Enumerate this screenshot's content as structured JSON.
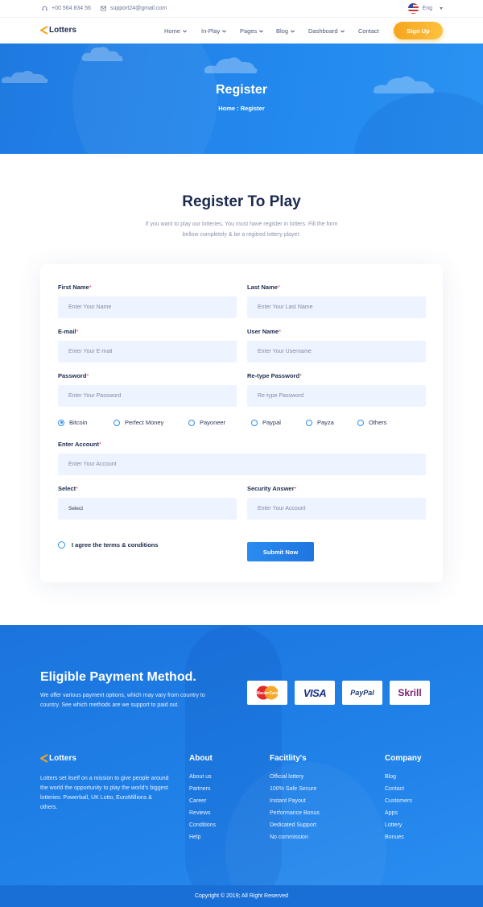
{
  "topbar": {
    "phone": "+00 564 834 56",
    "email": "support24@gmail.com",
    "language": "Eng"
  },
  "nav": {
    "logo": "Lotters",
    "items": [
      {
        "label": "Home",
        "dropdown": true
      },
      {
        "label": "In-Play",
        "dropdown": true
      },
      {
        "label": "Pages",
        "dropdown": true
      },
      {
        "label": "Blog",
        "dropdown": true
      },
      {
        "label": "Dashboard",
        "dropdown": true
      },
      {
        "label": "Contact",
        "dropdown": false
      }
    ],
    "signup": "Sign Up"
  },
  "hero": {
    "title": "Register",
    "breadcrumb": "Home : Register"
  },
  "section": {
    "title": "Register To Play",
    "subtitle": "If you want to play our lotteries, You must have register in lotters. Fill the form bellow completely & be a regitred lottery player."
  },
  "form": {
    "first_name": {
      "label": "First Name",
      "placeholder": "Enter Your Name"
    },
    "last_name": {
      "label": "Last Name",
      "placeholder": "Enter Your Last Name"
    },
    "email": {
      "label": "E-mail",
      "placeholder": "Enter Your E-mail"
    },
    "username": {
      "label": "User Name",
      "placeholder": "Enter Your Username"
    },
    "password": {
      "label": "Password",
      "placeholder": "Enter Your Password"
    },
    "retype": {
      "label": "Re-type Password",
      "placeholder": "Re-type Password"
    },
    "payment_methods": [
      "Bitcoin",
      "Perfect Money",
      "Payoneer",
      "Paypal",
      "Payza",
      "Others"
    ],
    "selected_payment": "Bitcoin",
    "account": {
      "label": "Enter Account",
      "placeholder": "Enter Your Account"
    },
    "select": {
      "label": "Select",
      "value": "Select"
    },
    "security": {
      "label": "Security Answer",
      "placeholder": "Enter Your Account"
    },
    "required_mark": "*",
    "agree": "I agree the terms & conditions",
    "submit": "Submit Now"
  },
  "payment": {
    "title": "Eligible Payment Method.",
    "text": "We offer various payment options, which may vary from country to country. See which methods are we support to paid out.",
    "cards": [
      "MasterCard",
      "VISA",
      "PayPal",
      "Skrill"
    ]
  },
  "footer": {
    "logo": "Lotters",
    "about": "Lotters set itself on a mission to give people around the world the opportunity to play the world's biggest lotteries: Powerball, UK Lotto, EuroMillions & others.",
    "columns": [
      {
        "title": "About",
        "links": [
          "About us",
          "Partners",
          "Career",
          "Reviews",
          "Conditions",
          "Help"
        ]
      },
      {
        "title": "Facitlity's",
        "links": [
          "Official lottery",
          "100% Safe Secure",
          "Instant Payout",
          "Performance Bonus",
          "Dedicated Support",
          "No commission"
        ]
      },
      {
        "title": "Company",
        "links": [
          "Blog",
          "Contact",
          "Customers",
          "Apps",
          "Lottery",
          "Bonues"
        ]
      }
    ],
    "copyright": "Copyright © 2019; All Right Reserved"
  },
  "colors": {
    "primary_blue": "#2288ee",
    "accent_orange": "#f6a41d",
    "dark_text": "#1b2a4e",
    "field_bg": "#eef4ff"
  }
}
